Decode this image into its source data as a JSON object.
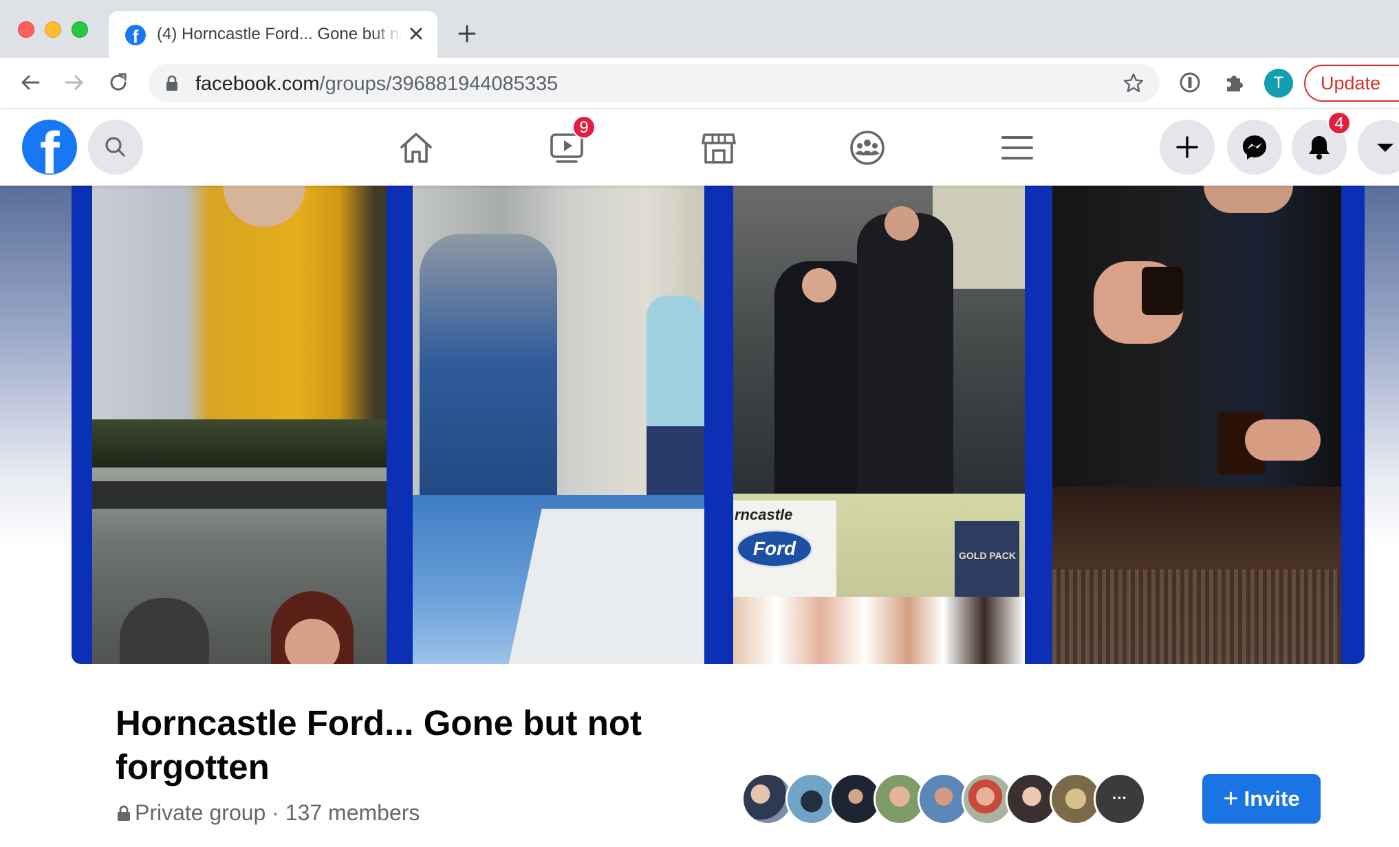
{
  "browser": {
    "tab_title": "(4) Horncastle Ford... Gone but not forgotten",
    "url_host": "facebook.com",
    "url_path": "/groups/396881944085335",
    "profile_initial": "T",
    "update_label": "Update"
  },
  "nav": {
    "watch_badge": "9",
    "notifications_badge": "4"
  },
  "cover_photos": {
    "ford_sign_text": "rncastle",
    "ford_logo_text": "Ford",
    "gold_pack_text": "GOLD PACK"
  },
  "group": {
    "title": "Horncastle Ford... Gone but not forgotten",
    "privacy": "Private group",
    "separator": "·",
    "members_count": "137 members",
    "invite_label": "Invite",
    "more_members_label": "···"
  },
  "colors": {
    "fb_blue": "#1877f2",
    "badge_red": "#e41e3f",
    "cover_border_blue": "#0b2fb5"
  }
}
